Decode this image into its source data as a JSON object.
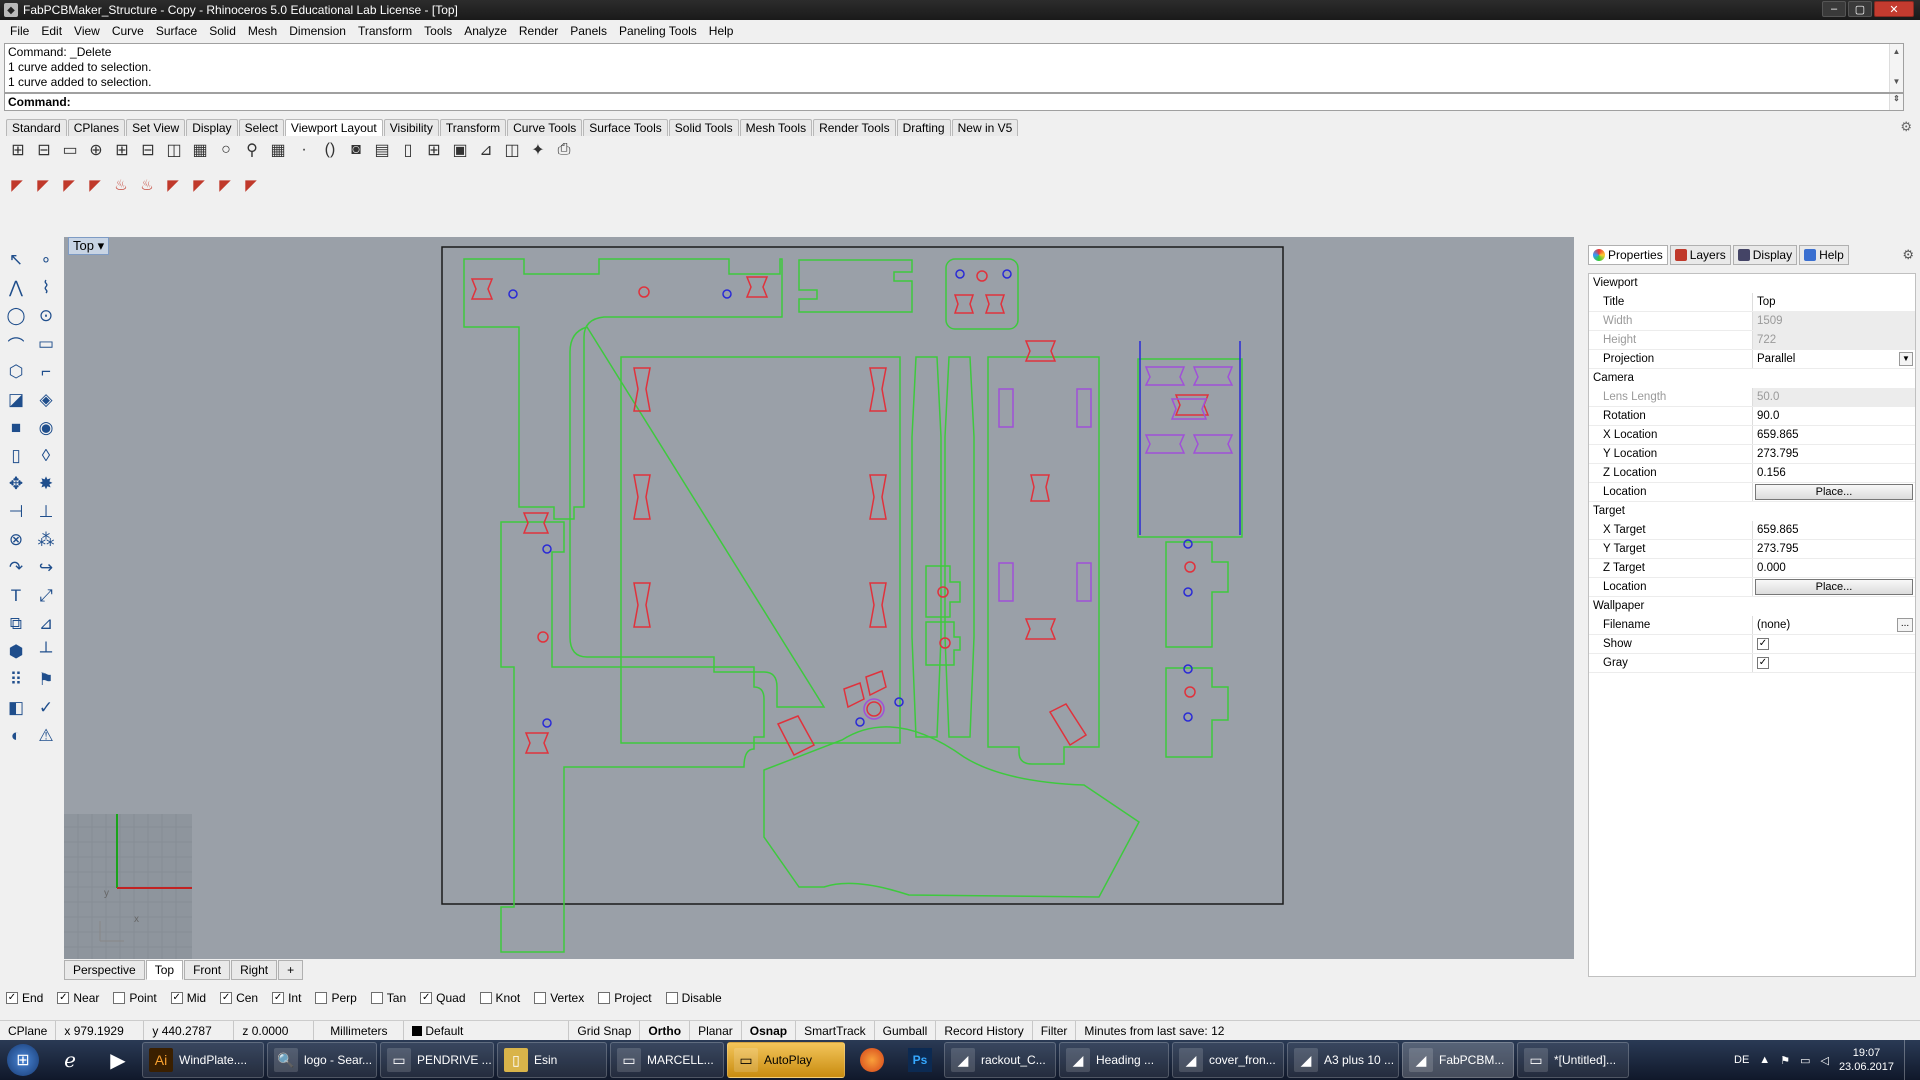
{
  "window": {
    "title": "FabPCBMaker_Structure - Copy - Rhinoceros 5.0 Educational Lab License - [Top]"
  },
  "menu": [
    "File",
    "Edit",
    "View",
    "Curve",
    "Surface",
    "Solid",
    "Mesh",
    "Dimension",
    "Transform",
    "Tools",
    "Analyze",
    "Render",
    "Panels",
    "Paneling Tools",
    "Help"
  ],
  "command": {
    "history": [
      "Command: _Delete",
      "1 curve added to selection.",
      "1 curve added to selection."
    ],
    "prompt": "Command:"
  },
  "toolbar_tabs": {
    "items": [
      "Standard",
      "CPlanes",
      "Set View",
      "Display",
      "Select",
      "Viewport Layout",
      "Visibility",
      "Transform",
      "Curve Tools",
      "Surface Tools",
      "Solid Tools",
      "Mesh Tools",
      "Render Tools",
      "Drafting",
      "New in V5"
    ],
    "active": "Viewport Layout"
  },
  "viewport": {
    "title": "Top",
    "menu_arrow": "▾"
  },
  "viewport_tabs": {
    "items": [
      "Perspective",
      "Top",
      "Front",
      "Right"
    ],
    "active": "Top",
    "add": "+"
  },
  "axis": {
    "x": "x",
    "y": "y"
  },
  "osnap": [
    {
      "label": "End",
      "checked": true
    },
    {
      "label": "Near",
      "checked": true
    },
    {
      "label": "Point",
      "checked": false
    },
    {
      "label": "Mid",
      "checked": true
    },
    {
      "label": "Cen",
      "checked": true
    },
    {
      "label": "Int",
      "checked": true
    },
    {
      "label": "Perp",
      "checked": false
    },
    {
      "label": "Tan",
      "checked": false
    },
    {
      "label": "Quad",
      "checked": true
    },
    {
      "label": "Knot",
      "checked": false
    },
    {
      "label": "Vertex",
      "checked": false
    },
    {
      "label": "Project",
      "checked": false
    },
    {
      "label": "Disable",
      "checked": false
    }
  ],
  "status": {
    "cplane": "CPlane",
    "x": "x 979.1929",
    "y": "y 440.2787",
    "z": "z 0.0000",
    "units": "Millimeters",
    "layer": "Default",
    "grid_snap": "Grid Snap",
    "ortho": "Ortho",
    "planar": "Planar",
    "osnap": "Osnap",
    "smarttrack": "SmartTrack",
    "gumball": "Gumball",
    "record_history": "Record History",
    "filter": "Filter",
    "minutes": "Minutes from last save: 12"
  },
  "panel": {
    "tabs": [
      "Properties",
      "Layers",
      "Display",
      "Help"
    ],
    "active_tab": "Properties",
    "sections": {
      "viewport": "Viewport",
      "camera": "Camera",
      "target": "Target",
      "wallpaper": "Wallpaper"
    },
    "viewport": {
      "title_label": "Title",
      "title": "Top",
      "width_label": "Width",
      "width": "1509",
      "height_label": "Height",
      "height": "722",
      "projection_label": "Projection",
      "projection": "Parallel"
    },
    "camera": {
      "lens_label": "Lens Length",
      "lens": "50.0",
      "rotation_label": "Rotation",
      "rotation": "90.0",
      "xloc_label": "X Location",
      "xloc": "659.865",
      "yloc_label": "Y Location",
      "yloc": "273.795",
      "zloc_label": "Z Location",
      "zloc": "0.156",
      "location_label": "Location",
      "place": "Place..."
    },
    "target": {
      "x_label": "X Target",
      "x": "659.865",
      "y_label": "Y Target",
      "y": "273.795",
      "z_label": "Z Target",
      "z": "0.000",
      "location_label": "Location",
      "place": "Place..."
    },
    "wallpaper": {
      "filename_label": "Filename",
      "filename": "(none)",
      "show_label": "Show",
      "show": true,
      "gray_label": "Gray",
      "gray": true,
      "browse": "..."
    }
  },
  "taskbar": {
    "tasks": [
      {
        "label": "WindPlate....",
        "icon": "Ai"
      },
      {
        "label": "logo - Sear...",
        "icon": "🔍"
      },
      {
        "label": "PENDRIVE ...",
        "icon": "▭"
      },
      {
        "label": "Esin",
        "icon": "▯"
      },
      {
        "label": "MARCELL...",
        "icon": "▭"
      },
      {
        "label": "AutoPlay",
        "icon": "▭",
        "active": true
      },
      {
        "label": "rackout_C...",
        "icon": "◢"
      },
      {
        "label": "Heading ...",
        "icon": "◢"
      },
      {
        "label": "cover_fron...",
        "icon": "◢"
      },
      {
        "label": "A3 plus 10 ...",
        "icon": "◢"
      },
      {
        "label": "FabPCBM...",
        "icon": "◢"
      },
      {
        "label": "*[Untitled]...",
        "icon": "▭"
      }
    ],
    "lang": "DE",
    "time": "19:07",
    "date": "23.06.2017"
  },
  "colors": {
    "green": "#3ec93e",
    "red": "#e0323c",
    "blue": "#2a2ad6",
    "purple": "#a050d8",
    "viewport_bg": "#9aa0a8"
  }
}
